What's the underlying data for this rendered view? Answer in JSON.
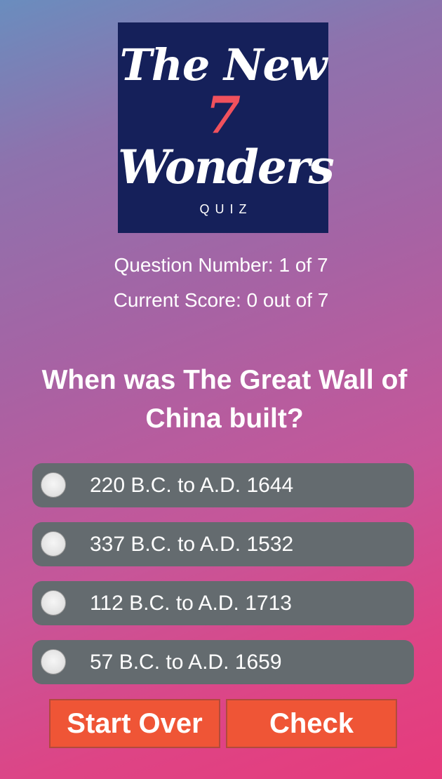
{
  "logo": {
    "line1": "The New",
    "number": "7",
    "line2": "Wonders",
    "subtitle": "QUIZ",
    "background_color": "#15205a",
    "accent_color": "#f0515d"
  },
  "status": {
    "question_number": "Question Number: 1 of 7",
    "current_score": "Current Score: 0 out of 7"
  },
  "question": {
    "text": "When was The Great Wall of China built?"
  },
  "options": [
    {
      "label": "220 B.C. to A.D. 1644",
      "selected": false
    },
    {
      "label": "337 B.C. to A.D. 1532",
      "selected": false
    },
    {
      "label": "112 B.C. to A.D. 1713",
      "selected": false
    },
    {
      "label": "57 B.C. to A.D. 1659",
      "selected": false
    }
  ],
  "buttons": {
    "start_over": "Start Over",
    "check": "Check",
    "color": "#ef5536"
  }
}
